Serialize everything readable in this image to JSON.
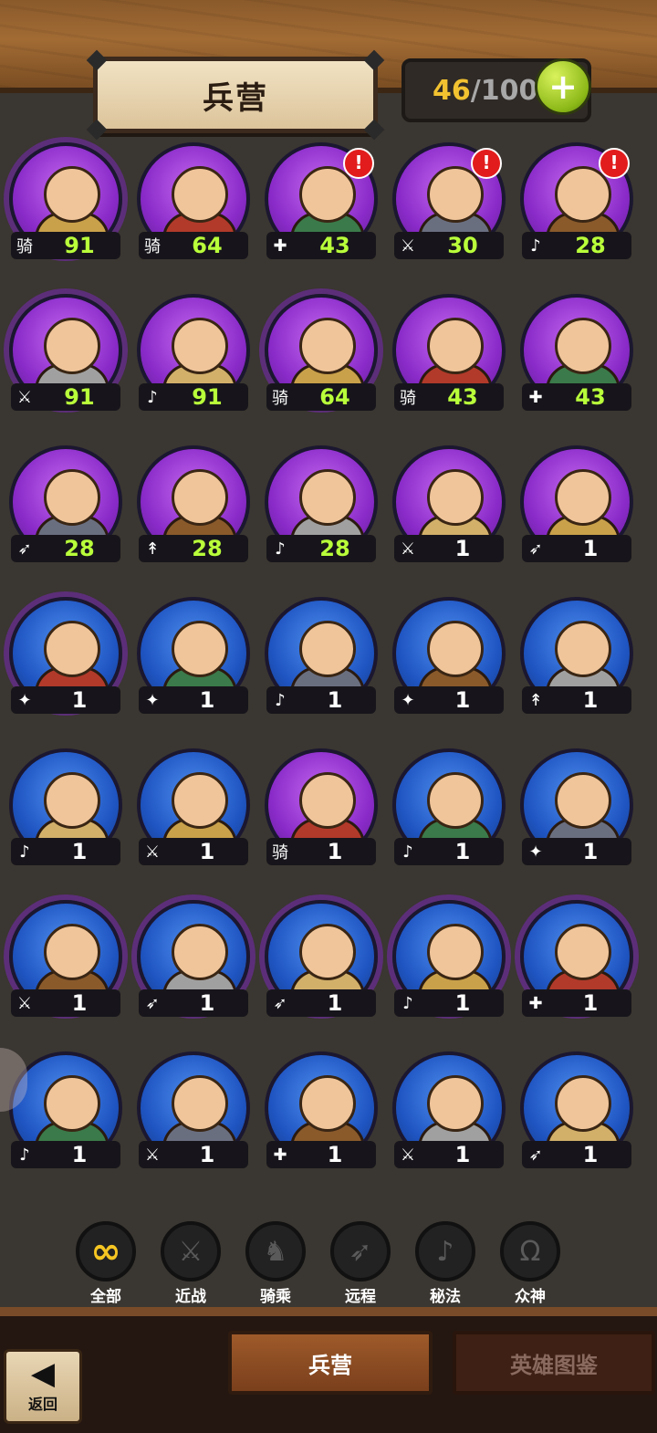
{
  "header": {
    "title": "兵营",
    "troop_count": "46",
    "troop_separator": "/",
    "troop_max": "100",
    "add_label": "+"
  },
  "units": [
    {
      "level": "91",
      "cls": "骑",
      "color": "purple",
      "spiky": true,
      "alert": false,
      "hi": true
    },
    {
      "level": "64",
      "cls": "骑",
      "color": "purple",
      "spiky": false,
      "alert": false,
      "hi": true
    },
    {
      "level": "43",
      "cls": "✚",
      "color": "purple",
      "spiky": false,
      "alert": true,
      "hi": true
    },
    {
      "level": "30",
      "cls": "⚔",
      "color": "purple",
      "spiky": false,
      "alert": true,
      "hi": true
    },
    {
      "level": "28",
      "cls": "♪",
      "color": "purple",
      "spiky": false,
      "alert": true,
      "hi": true
    },
    {
      "level": "91",
      "cls": "⚔",
      "color": "purple",
      "spiky": true,
      "alert": false,
      "hi": true
    },
    {
      "level": "91",
      "cls": "♪",
      "color": "purple",
      "spiky": false,
      "alert": false,
      "hi": true
    },
    {
      "level": "64",
      "cls": "骑",
      "color": "purple",
      "spiky": true,
      "alert": false,
      "hi": true
    },
    {
      "level": "43",
      "cls": "骑",
      "color": "purple",
      "spiky": false,
      "alert": false,
      "hi": true
    },
    {
      "level": "43",
      "cls": "✚",
      "color": "purple",
      "spiky": false,
      "alert": false,
      "hi": true
    },
    {
      "level": "28",
      "cls": "➶",
      "color": "purple",
      "spiky": false,
      "alert": false,
      "hi": true
    },
    {
      "level": "28",
      "cls": "↟",
      "color": "purple",
      "spiky": false,
      "alert": false,
      "hi": true
    },
    {
      "level": "28",
      "cls": "♪",
      "color": "purple",
      "spiky": false,
      "alert": false,
      "hi": true
    },
    {
      "level": "1",
      "cls": "⚔",
      "color": "purple",
      "spiky": false,
      "alert": false,
      "hi": false
    },
    {
      "level": "1",
      "cls": "➶",
      "color": "purple",
      "spiky": false,
      "alert": false,
      "hi": false
    },
    {
      "level": "1",
      "cls": "✦",
      "color": "blue",
      "spiky": true,
      "alert": false,
      "hi": false
    },
    {
      "level": "1",
      "cls": "✦",
      "color": "blue",
      "spiky": false,
      "alert": false,
      "hi": false
    },
    {
      "level": "1",
      "cls": "♪",
      "color": "blue",
      "spiky": false,
      "alert": false,
      "hi": false
    },
    {
      "level": "1",
      "cls": "✦",
      "color": "blue",
      "spiky": false,
      "alert": false,
      "hi": false
    },
    {
      "level": "1",
      "cls": "↟",
      "color": "blue",
      "spiky": false,
      "alert": false,
      "hi": false
    },
    {
      "level": "1",
      "cls": "♪",
      "color": "blue",
      "spiky": false,
      "alert": false,
      "hi": false
    },
    {
      "level": "1",
      "cls": "⚔",
      "color": "blue",
      "spiky": false,
      "alert": false,
      "hi": false
    },
    {
      "level": "1",
      "cls": "骑",
      "color": "purple",
      "spiky": false,
      "alert": false,
      "hi": false
    },
    {
      "level": "1",
      "cls": "♪",
      "color": "blue",
      "spiky": false,
      "alert": false,
      "hi": false
    },
    {
      "level": "1",
      "cls": "✦",
      "color": "blue",
      "spiky": false,
      "alert": false,
      "hi": false
    },
    {
      "level": "1",
      "cls": "⚔",
      "color": "blue",
      "spiky": true,
      "alert": false,
      "hi": false
    },
    {
      "level": "1",
      "cls": "➶",
      "color": "blue",
      "spiky": true,
      "alert": false,
      "hi": false
    },
    {
      "level": "1",
      "cls": "➶",
      "color": "blue",
      "spiky": true,
      "alert": false,
      "hi": false
    },
    {
      "level": "1",
      "cls": "♪",
      "color": "blue",
      "spiky": true,
      "alert": false,
      "hi": false
    },
    {
      "level": "1",
      "cls": "✚",
      "color": "blue",
      "spiky": true,
      "alert": false,
      "hi": false
    },
    {
      "level": "1",
      "cls": "♪",
      "color": "blue",
      "spiky": false,
      "alert": false,
      "hi": false
    },
    {
      "level": "1",
      "cls": "⚔",
      "color": "blue",
      "spiky": false,
      "alert": false,
      "hi": false
    },
    {
      "level": "1",
      "cls": "✚",
      "color": "blue",
      "spiky": false,
      "alert": false,
      "hi": false
    },
    {
      "level": "1",
      "cls": "⚔",
      "color": "blue",
      "spiky": false,
      "alert": false,
      "hi": false
    },
    {
      "level": "1",
      "cls": "➶",
      "color": "blue",
      "spiky": false,
      "alert": false,
      "hi": false
    }
  ],
  "filters": [
    {
      "label": "全部",
      "icon": "∞",
      "active": true
    },
    {
      "label": "近战",
      "icon": "⚔",
      "active": false
    },
    {
      "label": "骑乘",
      "icon": "♞",
      "active": false
    },
    {
      "label": "远程",
      "icon": "➶",
      "active": false
    },
    {
      "label": "秘法",
      "icon": "♪",
      "active": false
    },
    {
      "label": "众神",
      "icon": "Ω",
      "active": false
    }
  ],
  "nav": {
    "back_label": "返回",
    "back_icon": "◀",
    "tab_barracks": "兵营",
    "tab_codex": "英雄图鉴"
  },
  "colors": {
    "level_high": "#b9ff3a",
    "level_low": "#ffffff",
    "rarity_epic": "#8a2bc9",
    "rarity_rare": "#1f55c2",
    "alert": "#e21c1c"
  }
}
